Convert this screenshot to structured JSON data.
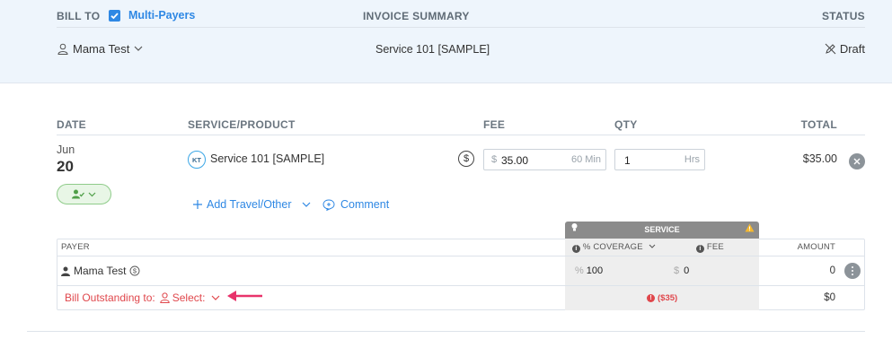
{
  "header": {
    "bill_to_label": "BILL TO",
    "multi_payers_label": "Multi-Payers",
    "multi_payers_checked": true,
    "invoice_summary_label": "INVOICE SUMMARY",
    "status_label": "STATUS",
    "payer_name": "Mama Test",
    "summary_text": "Service 101 [SAMPLE]",
    "status_value": "Draft"
  },
  "table": {
    "col_date": "DATE",
    "col_service": "SERVICE/PRODUCT",
    "col_fee": "FEE",
    "col_qty": "QTY",
    "col_total": "TOTAL"
  },
  "line_item": {
    "month": "Jun",
    "day": "20",
    "provider_initials": "KT",
    "service_name": "Service 101 [SAMPLE]",
    "fee_currency": "$",
    "fee_value": "35.00",
    "fee_unit": "60 Min",
    "qty_value": "1",
    "qty_unit": "Hrs",
    "total": "$35.00",
    "add_travel_label": "Add Travel/Other",
    "comment_label": "Comment"
  },
  "payer_table": {
    "service_tab_label": "SERVICE",
    "col_payer": "PAYER",
    "col_coverage": "% COVERAGE",
    "col_fee": "FEE",
    "col_amount": "AMOUNT",
    "rows": [
      {
        "name": "Mama Test",
        "coverage_prefix": "%",
        "coverage": "100",
        "fee_prefix": "$",
        "fee": "0",
        "amount": "0"
      }
    ],
    "outstanding_label": "Bill Outstanding to:",
    "outstanding_select": "Select:",
    "outstanding_amount": "($35)",
    "outstanding_total": "$0"
  },
  "colors": {
    "accent": "#2f88e4",
    "danger": "#e0474c",
    "arrow": "#e8336b",
    "success": "#5cae55"
  }
}
